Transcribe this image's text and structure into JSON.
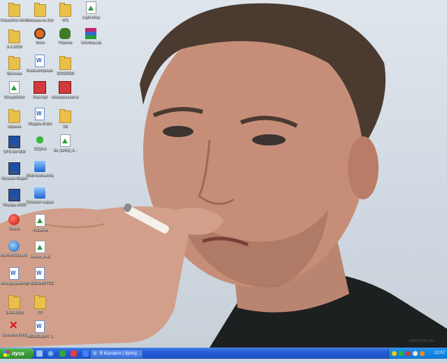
{
  "desktop": {
    "icons": [
      {
        "label": "Служебно Инто",
        "icon": "folder-icon"
      },
      {
        "label": "Фильмы из Zonafilm",
        "icon": "folder-icon"
      },
      {
        "label": "471",
        "icon": "folder-icon"
      },
      {
        "label": "Light Alloy",
        "icon": "light-alloy-icon"
      },
      {
        "label": "3-1-2009",
        "icon": "folder-icon"
      },
      {
        "label": "Фото",
        "icon": "camera-icon"
      },
      {
        "label": "Пароли",
        "icon": "bug-icon"
      },
      {
        "label": "LKsetup.zip",
        "icon": "winrar-icon"
      },
      {
        "label": "фильмы",
        "icon": "folder-icon"
      },
      {
        "label": "Компьютерная интернет.doc",
        "icon": "word-doc-icon"
      },
      {
        "label": "20090930",
        "icon": "folder-icon"
      },
      {
        "label": "GroupOffice",
        "icon": "image-icon"
      },
      {
        "label": "Kavi-Syl",
        "icon": "tool-icon"
      },
      {
        "label": "Электронная консультан...",
        "icon": "archive-icon"
      },
      {
        "label": "музыка",
        "icon": "folder-icon"
      },
      {
        "label": "Модуль 8.doc",
        "icon": "word-doc-icon"
      },
      {
        "label": "08",
        "icon": "folder-icon"
      },
      {
        "label": "STS Hd WW",
        "icon": "monitor-icon"
      },
      {
        "label": "ICQ6.5",
        "icon": "icq-icon"
      },
      {
        "label": "do_family_il...",
        "icon": "image-icon"
      },
      {
        "label": "Музыка Видео",
        "icon": "monitor-icon"
      },
      {
        "label": "Мой компьютер",
        "icon": "my-computer-icon"
      },
      {
        "label": "Январь-2010",
        "icon": "monitor-icon"
      },
      {
        "label": "Сетевое окружение",
        "icon": "network-icon"
      },
      {
        "label": "Opera",
        "icon": "opera-icon"
      },
      {
        "label": "Корзина",
        "icon": "recycle-bin-icon"
      },
      {
        "label": "Internet Explorer",
        "icon": "internet-explorer-icon"
      },
      {
        "label": "kanye_final",
        "icon": "image-icon"
      },
      {
        "label": "Мои документы",
        "icon": "my-documents-icon"
      },
      {
        "label": "УЧЕБНЫЙ ГОСУДАРС...",
        "icon": "word-doc-icon"
      },
      {
        "label": "3-16-2009",
        "icon": "folder-icon"
      },
      {
        "label": "FF",
        "icon": "folder-icon"
      },
      {
        "label": "Combine DVD",
        "icon": "x-icon"
      },
      {
        "label": "ЭКОНОМИЧ. ОБРАЗОВА...",
        "icon": "document-icon"
      }
    ]
  },
  "taskbar": {
    "start_label": "пуск",
    "task_label": "В Контакте | Spring ...",
    "clock": "12:07"
  },
  "watermark": "KINOPOISK.RU"
}
